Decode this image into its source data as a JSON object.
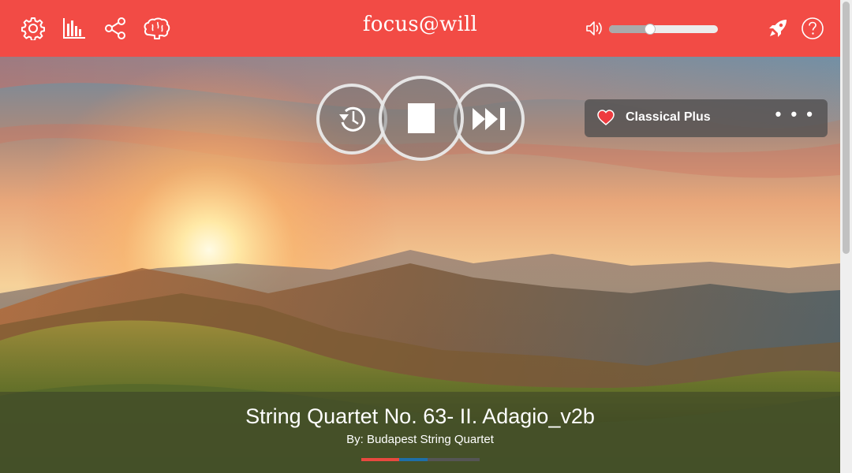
{
  "app": {
    "brand": "focus@will"
  },
  "header": {
    "icons": [
      "gear-icon",
      "bar-chart-icon",
      "share-icon",
      "brain-icon"
    ],
    "right_icons": [
      "rocket-icon",
      "help-icon"
    ],
    "volume": {
      "level": 0.38
    }
  },
  "player": {
    "controls": [
      "timer-button",
      "stop-button",
      "skip-button"
    ],
    "playlist": {
      "name": "Classical Plus",
      "more": "• • •",
      "favorite": true
    }
  },
  "now_playing": {
    "title": "String Quartet No. 63- II. Adagio_v2b",
    "artist": "By: Budapest String Quartet",
    "progress": 0.32,
    "buffered": 0.56
  },
  "colors": {
    "accent": "#f24b45",
    "progress_played": "#e8493f",
    "progress_buffered": "#1e6fa8"
  }
}
